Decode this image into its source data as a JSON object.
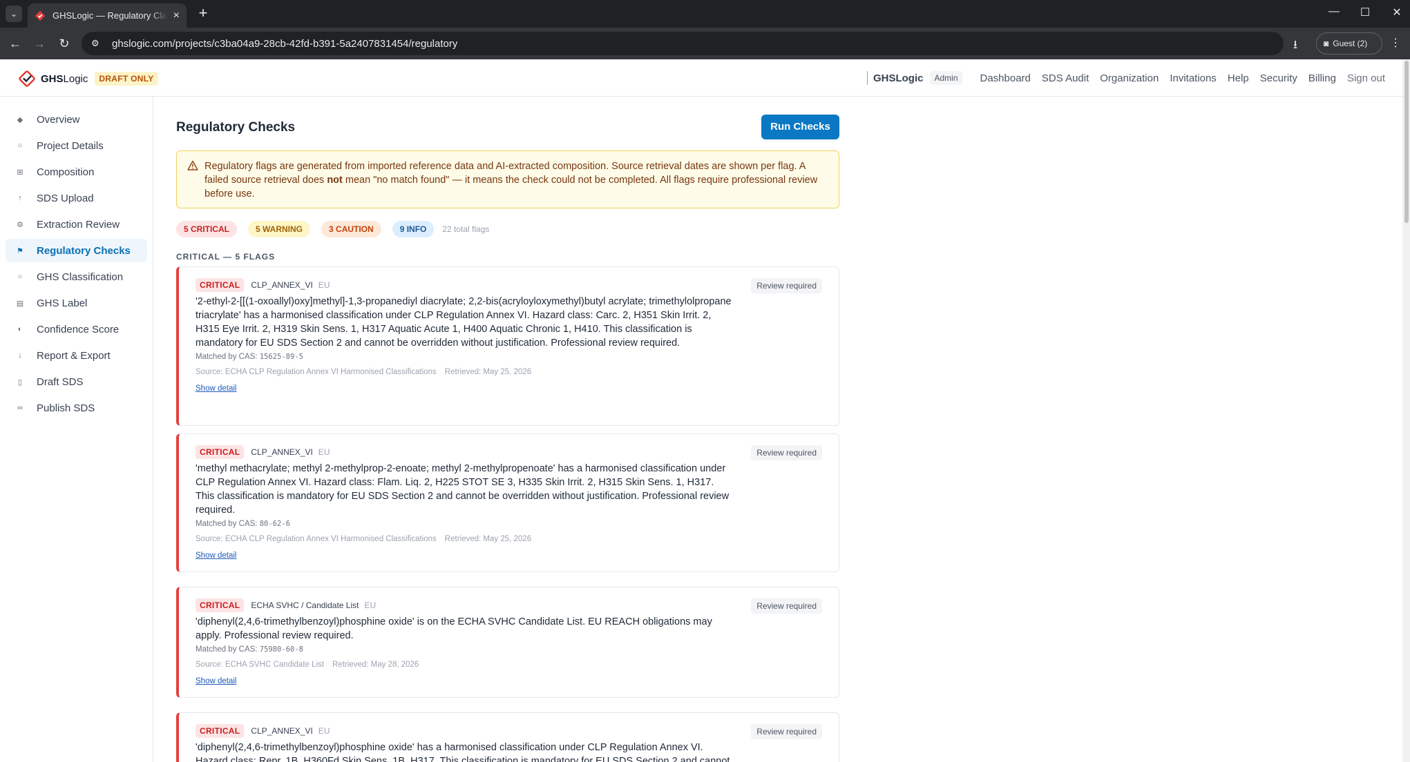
{
  "browser": {
    "tab_title": "GHSLogic — Regulatory Classification",
    "url": "ghslogic.com/projects/c3ba04a9-28cb-42fd-b391-5a2407831454/regulatory",
    "profile_label": "Guest (2)"
  },
  "header": {
    "logo_bold": "GHS",
    "logo_rest": "Logic",
    "draft_badge": "DRAFT ONLY",
    "brand": "GHSLogic",
    "role_badge": "Admin",
    "nav": [
      "Dashboard",
      "SDS Audit",
      "Organization",
      "Invitations",
      "Help",
      "Security",
      "Billing",
      "Sign out"
    ]
  },
  "sidebar": {
    "items": [
      {
        "label": "Overview",
        "icon": "diamond-icon"
      },
      {
        "label": "Project Details",
        "icon": "circle-icon"
      },
      {
        "label": "Composition",
        "icon": "grid-icon"
      },
      {
        "label": "SDS Upload",
        "icon": "upload-icon"
      },
      {
        "label": "Extraction Review",
        "icon": "gear-icon"
      },
      {
        "label": "Regulatory Checks",
        "icon": "flag-icon"
      },
      {
        "label": "GHS Classification",
        "icon": "circle-icon"
      },
      {
        "label": "GHS Label",
        "icon": "label-icon"
      },
      {
        "label": "Confidence Score",
        "icon": "half-circle-icon"
      },
      {
        "label": "Report & Export",
        "icon": "download-icon"
      },
      {
        "label": "Draft SDS",
        "icon": "document-icon"
      },
      {
        "label": "Publish SDS",
        "icon": "link-icon"
      }
    ],
    "active_index": 5
  },
  "main": {
    "title": "Regulatory Checks",
    "run_button": "Run Checks",
    "notice": {
      "part1": "Regulatory flags are generated from imported reference data and AI-extracted composition. Source retrieval dates are shown per flag. A failed source retrieval does ",
      "bold": "not",
      "part2": " mean \"no match found\" — it means the check could not be completed. All flags require professional review before use."
    },
    "summary": {
      "critical": "5 CRITICAL",
      "warning": "5 WARNING",
      "caution": "3 CAUTION",
      "info": "9 INFO",
      "total": "22 total flags"
    },
    "section_title": "CRITICAL — 5 FLAGS",
    "flags": [
      {
        "severity": "CRITICAL",
        "rule": "CLP_ANNEX_VI",
        "region": "EU",
        "review": "Review required",
        "message": "'2-ethyl-2-[[(1-oxoallyl)oxy]methyl]-1,3-propanediyl diacrylate; 2,2-bis(acryloyloxymethyl)butyl acrylate; trimethylolpropane triacrylate' has a harmonised classification under CLP Regulation Annex VI. Hazard class: Carc. 2, H351 Skin Irrit. 2, H315 Eye Irrit. 2, H319 Skin Sens. 1, H317 Aquatic Acute 1, H400 Aquatic Chronic 1, H410. This classification is mandatory for EU SDS Section 2 and cannot be overridden without justification. Professional review required.",
        "matched_prefix": "Matched by CAS:",
        "cas": "15625-89-5",
        "source": "Source: ECHA CLP Regulation Annex VI Harmonised Classifications",
        "retrieved": "Retrieved: May 25, 2026",
        "detail": "Show detail"
      },
      {
        "severity": "CRITICAL",
        "rule": "CLP_ANNEX_VI",
        "region": "EU",
        "review": "Review required",
        "message": "'methyl methacrylate; methyl 2-methylprop-2-enoate; methyl 2-methylpropenoate' has a harmonised classification under CLP Regulation Annex VI. Hazard class: Flam. Liq. 2, H225 STOT SE 3, H335 Skin Irrit. 2, H315 Skin Sens. 1, H317. This classification is mandatory for EU SDS Section 2 and cannot be overridden without justification. Professional review required.",
        "matched_prefix": "Matched by CAS:",
        "cas": "80-62-6",
        "source": "Source: ECHA CLP Regulation Annex VI Harmonised Classifications",
        "retrieved": "Retrieved: May 25, 2026",
        "detail": "Show detail"
      },
      {
        "severity": "CRITICAL",
        "rule": "ECHA SVHC / Candidate List",
        "region": "EU",
        "review": "Review required",
        "message": "'diphenyl(2,4,6-trimethylbenzoyl)phosphine oxide' is on the ECHA SVHC Candidate List. EU REACH obligations may apply. Professional review required.",
        "matched_prefix": "Matched by CAS:",
        "cas": "75980-60-8",
        "source": "Source: ECHA SVHC Candidate List",
        "retrieved": "Retrieved: May 28, 2026",
        "detail": "Show detail"
      },
      {
        "severity": "CRITICAL",
        "rule": "CLP_ANNEX_VI",
        "region": "EU",
        "review": "Review required",
        "message": "'diphenyl(2,4,6-trimethylbenzoyl)phosphine oxide' has a harmonised classification under CLP Regulation Annex VI. Hazard class: Repr. 1B, H360Fd Skin Sens. 1B, H317. This classification is mandatory for EU SDS Section 2 and cannot be overridden without justification. Professional review required."
      }
    ]
  },
  "colors": {
    "accent": "#0b78c4",
    "critical": "#e24141",
    "notice_bg": "#fefce8"
  }
}
